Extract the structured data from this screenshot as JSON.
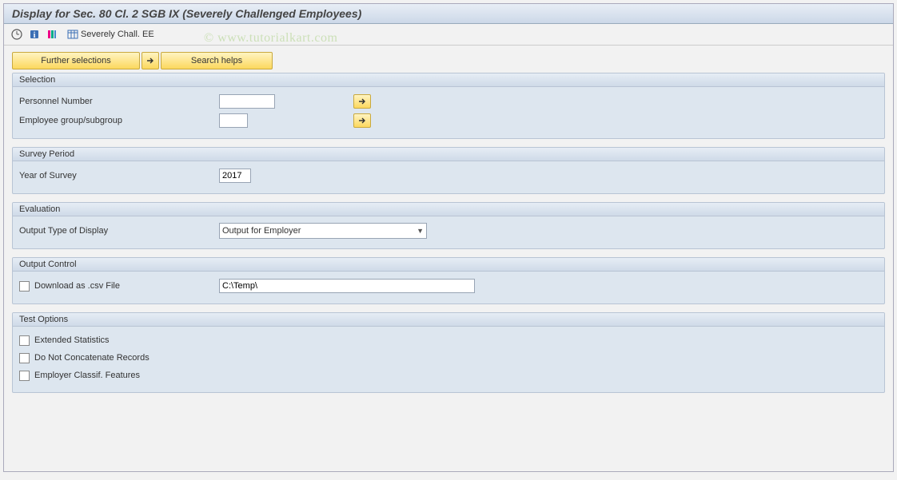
{
  "title": "Display for Sec. 80 Cl. 2 SGB IX (Severely Challenged Employees)",
  "watermark": "© www.tutorialkart.com",
  "toolbar": {
    "severely_label": "Severely Chall. EE"
  },
  "buttons": {
    "further_selections": "Further selections",
    "search_helps": "Search helps"
  },
  "groups": {
    "selection": {
      "title": "Selection",
      "personnel_number_label": "Personnel Number",
      "personnel_number_value": "",
      "employee_group_label": "Employee group/subgroup",
      "employee_group_value": ""
    },
    "survey": {
      "title": "Survey Period",
      "year_label": "Year of Survey",
      "year_value": "2017"
    },
    "evaluation": {
      "title": "Evaluation",
      "output_type_label": "Output Type of Display",
      "output_type_value": "Output for Employer"
    },
    "output_control": {
      "title": "Output Control",
      "download_label": "Download as .csv File",
      "path_value": "C:\\Temp\\"
    },
    "test_options": {
      "title": "Test Options",
      "extended_stats": "Extended Statistics",
      "no_concat": "Do Not Concatenate Records",
      "employer_classif": "Employer Classif. Features"
    }
  }
}
